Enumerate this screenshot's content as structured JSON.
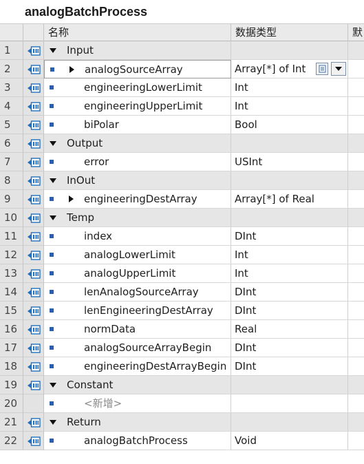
{
  "title": "analogBatchProcess",
  "header": {
    "name_col": "名称",
    "type_col": "数据类型",
    "extra_col": "默"
  },
  "rows": [
    {
      "num": "1",
      "name": "Input",
      "type": "",
      "kind": "section",
      "icon": true
    },
    {
      "num": "2",
      "name": "analogSourceArray",
      "type": "Array[*] of Int",
      "kind": "child",
      "expandable": true,
      "selected": true,
      "icon": true
    },
    {
      "num": "3",
      "name": "engineeringLowerLimit",
      "type": "Int",
      "kind": "child",
      "icon": true
    },
    {
      "num": "4",
      "name": "engineeringUpperLimit",
      "type": "Int",
      "kind": "child",
      "icon": true
    },
    {
      "num": "5",
      "name": "biPolar",
      "type": "Bool",
      "kind": "child",
      "icon": true
    },
    {
      "num": "6",
      "name": "Output",
      "type": "",
      "kind": "section",
      "icon": true
    },
    {
      "num": "7",
      "name": "error",
      "type": "USInt",
      "kind": "child",
      "icon": true
    },
    {
      "num": "8",
      "name": "InOut",
      "type": "",
      "kind": "section",
      "icon": true
    },
    {
      "num": "9",
      "name": "engineeringDestArray",
      "type": "Array[*] of Real",
      "kind": "child",
      "expandable": true,
      "icon": true
    },
    {
      "num": "10",
      "name": "Temp",
      "type": "",
      "kind": "section",
      "icon": true
    },
    {
      "num": "11",
      "name": "index",
      "type": "DInt",
      "kind": "child",
      "icon": true
    },
    {
      "num": "12",
      "name": "analogLowerLimit",
      "type": "Int",
      "kind": "child",
      "icon": true
    },
    {
      "num": "13",
      "name": "analogUpperLimit",
      "type": "Int",
      "kind": "child",
      "icon": true
    },
    {
      "num": "14",
      "name": "lenAnalogSourceArray",
      "type": "DInt",
      "kind": "child",
      "icon": true
    },
    {
      "num": "15",
      "name": "lenEngineeringDestArray",
      "type": "DInt",
      "kind": "child",
      "icon": true
    },
    {
      "num": "16",
      "name": "normData",
      "type": "Real",
      "kind": "child",
      "icon": true
    },
    {
      "num": "17",
      "name": "analogSourceArrayBegin",
      "type": "DInt",
      "kind": "child",
      "icon": true
    },
    {
      "num": "18",
      "name": "engineeringDestArrayBegin",
      "type": "DInt",
      "kind": "child",
      "icon": true
    },
    {
      "num": "19",
      "name": "Constant",
      "type": "",
      "kind": "section",
      "icon": true
    },
    {
      "num": "20",
      "name": "<新增>",
      "type": "",
      "kind": "placeholder",
      "icon": false
    },
    {
      "num": "21",
      "name": "Return",
      "type": "",
      "kind": "section",
      "icon": true
    },
    {
      "num": "22",
      "name": "analogBatchProcess",
      "type": "Void",
      "kind": "child",
      "icon": true
    }
  ],
  "colors": {
    "accent_dot": "#2a5fb0",
    "io_icon": "#1f6fbf",
    "section_bg": "#e6e6e6"
  }
}
